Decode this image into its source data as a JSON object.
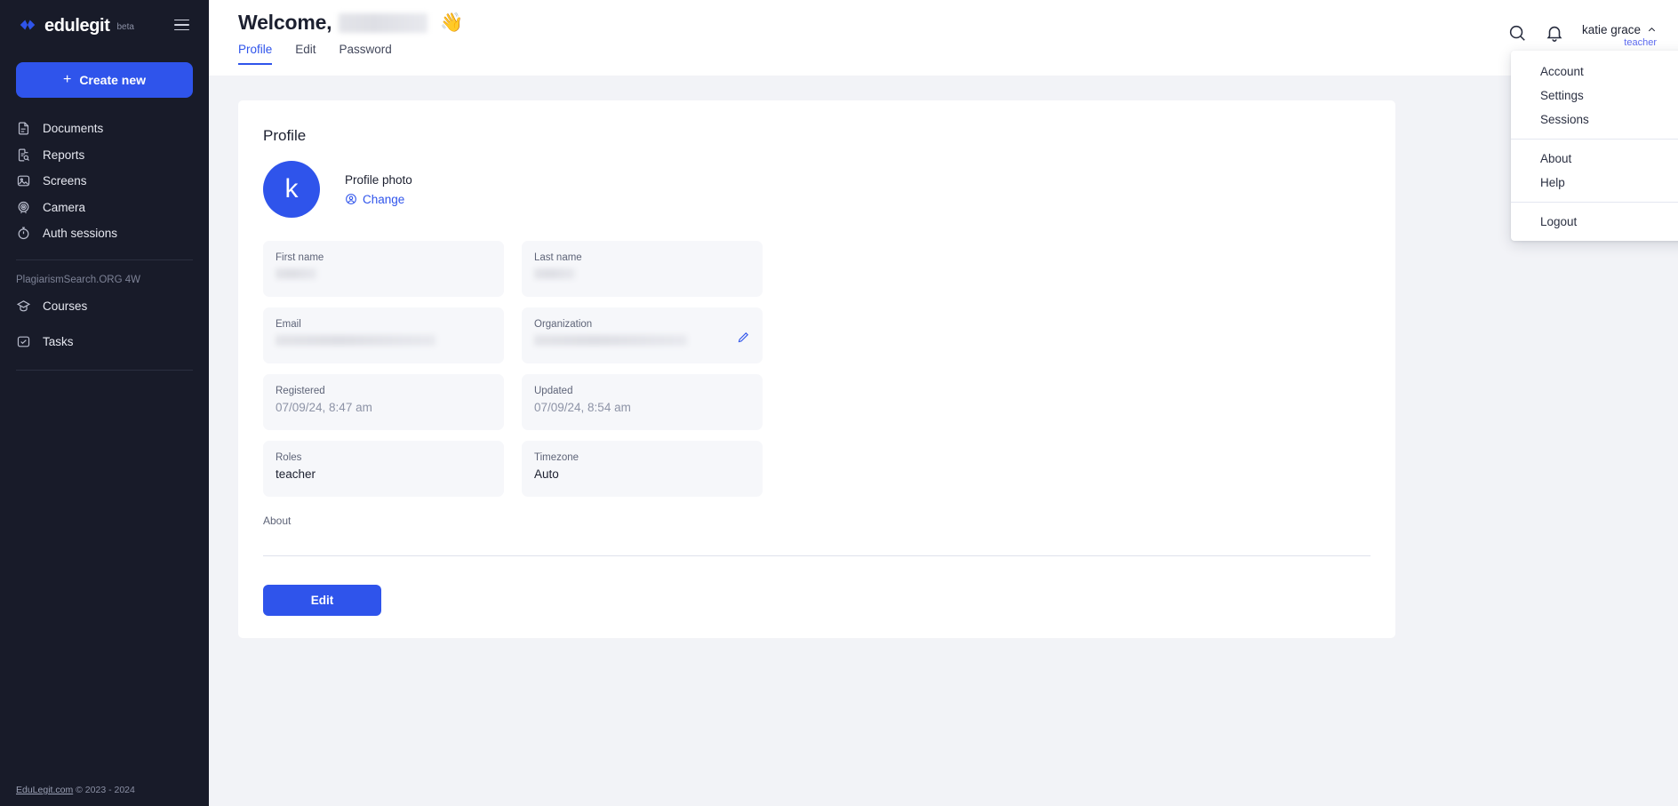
{
  "sidebar": {
    "logo_text": "edulegit",
    "logo_beta": "beta",
    "create_button": "Create new",
    "nav_items": [
      {
        "label": "Documents",
        "icon": "document-icon"
      },
      {
        "label": "Reports",
        "icon": "report-search-icon"
      },
      {
        "label": "Screens",
        "icon": "image-icon"
      },
      {
        "label": "Camera",
        "icon": "camera-icon"
      },
      {
        "label": "Auth sessions",
        "icon": "timer-icon"
      }
    ],
    "section_label": "PlagiarismSearch.ORG 4W",
    "section_items": [
      {
        "label": "Courses",
        "icon": "graduation-cap-icon"
      },
      {
        "label": "Tasks",
        "icon": "task-check-icon"
      }
    ],
    "footer_link": "EduLegit.com",
    "footer_text": "© 2023 - 2024"
  },
  "header": {
    "welcome": "Welcome,",
    "wave_emoji": "👋",
    "tabs": [
      {
        "label": "Profile",
        "active": true
      },
      {
        "label": "Edit",
        "active": false
      },
      {
        "label": "Password",
        "active": false
      }
    ],
    "user_name": "katie grace",
    "user_role": "teacher"
  },
  "dropdown": {
    "group1": [
      "Account",
      "Settings",
      "Sessions"
    ],
    "group2": [
      "About",
      "Help"
    ],
    "group3": [
      "Logout"
    ]
  },
  "profile": {
    "card_title": "Profile",
    "avatar_letter": "k",
    "photo_label": "Profile photo",
    "change_label": "Change",
    "fields": [
      {
        "label": "First name",
        "value": "",
        "redacted": "sm"
      },
      {
        "label": "Last name",
        "value": "",
        "redacted": "sm"
      },
      {
        "label": "Email",
        "value": "",
        "redacted": "md"
      },
      {
        "label": "Organization",
        "value": "",
        "redacted": "lg",
        "pencil": true
      },
      {
        "label": "Registered",
        "value": "07/09/24, 8:47 am",
        "muted": true
      },
      {
        "label": "Updated",
        "value": "07/09/24, 8:54 am",
        "muted": true
      },
      {
        "label": "Roles",
        "value": "teacher"
      },
      {
        "label": "Timezone",
        "value": "Auto"
      }
    ],
    "about_label": "About",
    "edit_button": "Edit"
  },
  "colors": {
    "accent": "#2f54eb",
    "sidebar_bg": "#181b29",
    "page_bg": "#f2f3f7",
    "field_bg": "#f6f7fa"
  }
}
